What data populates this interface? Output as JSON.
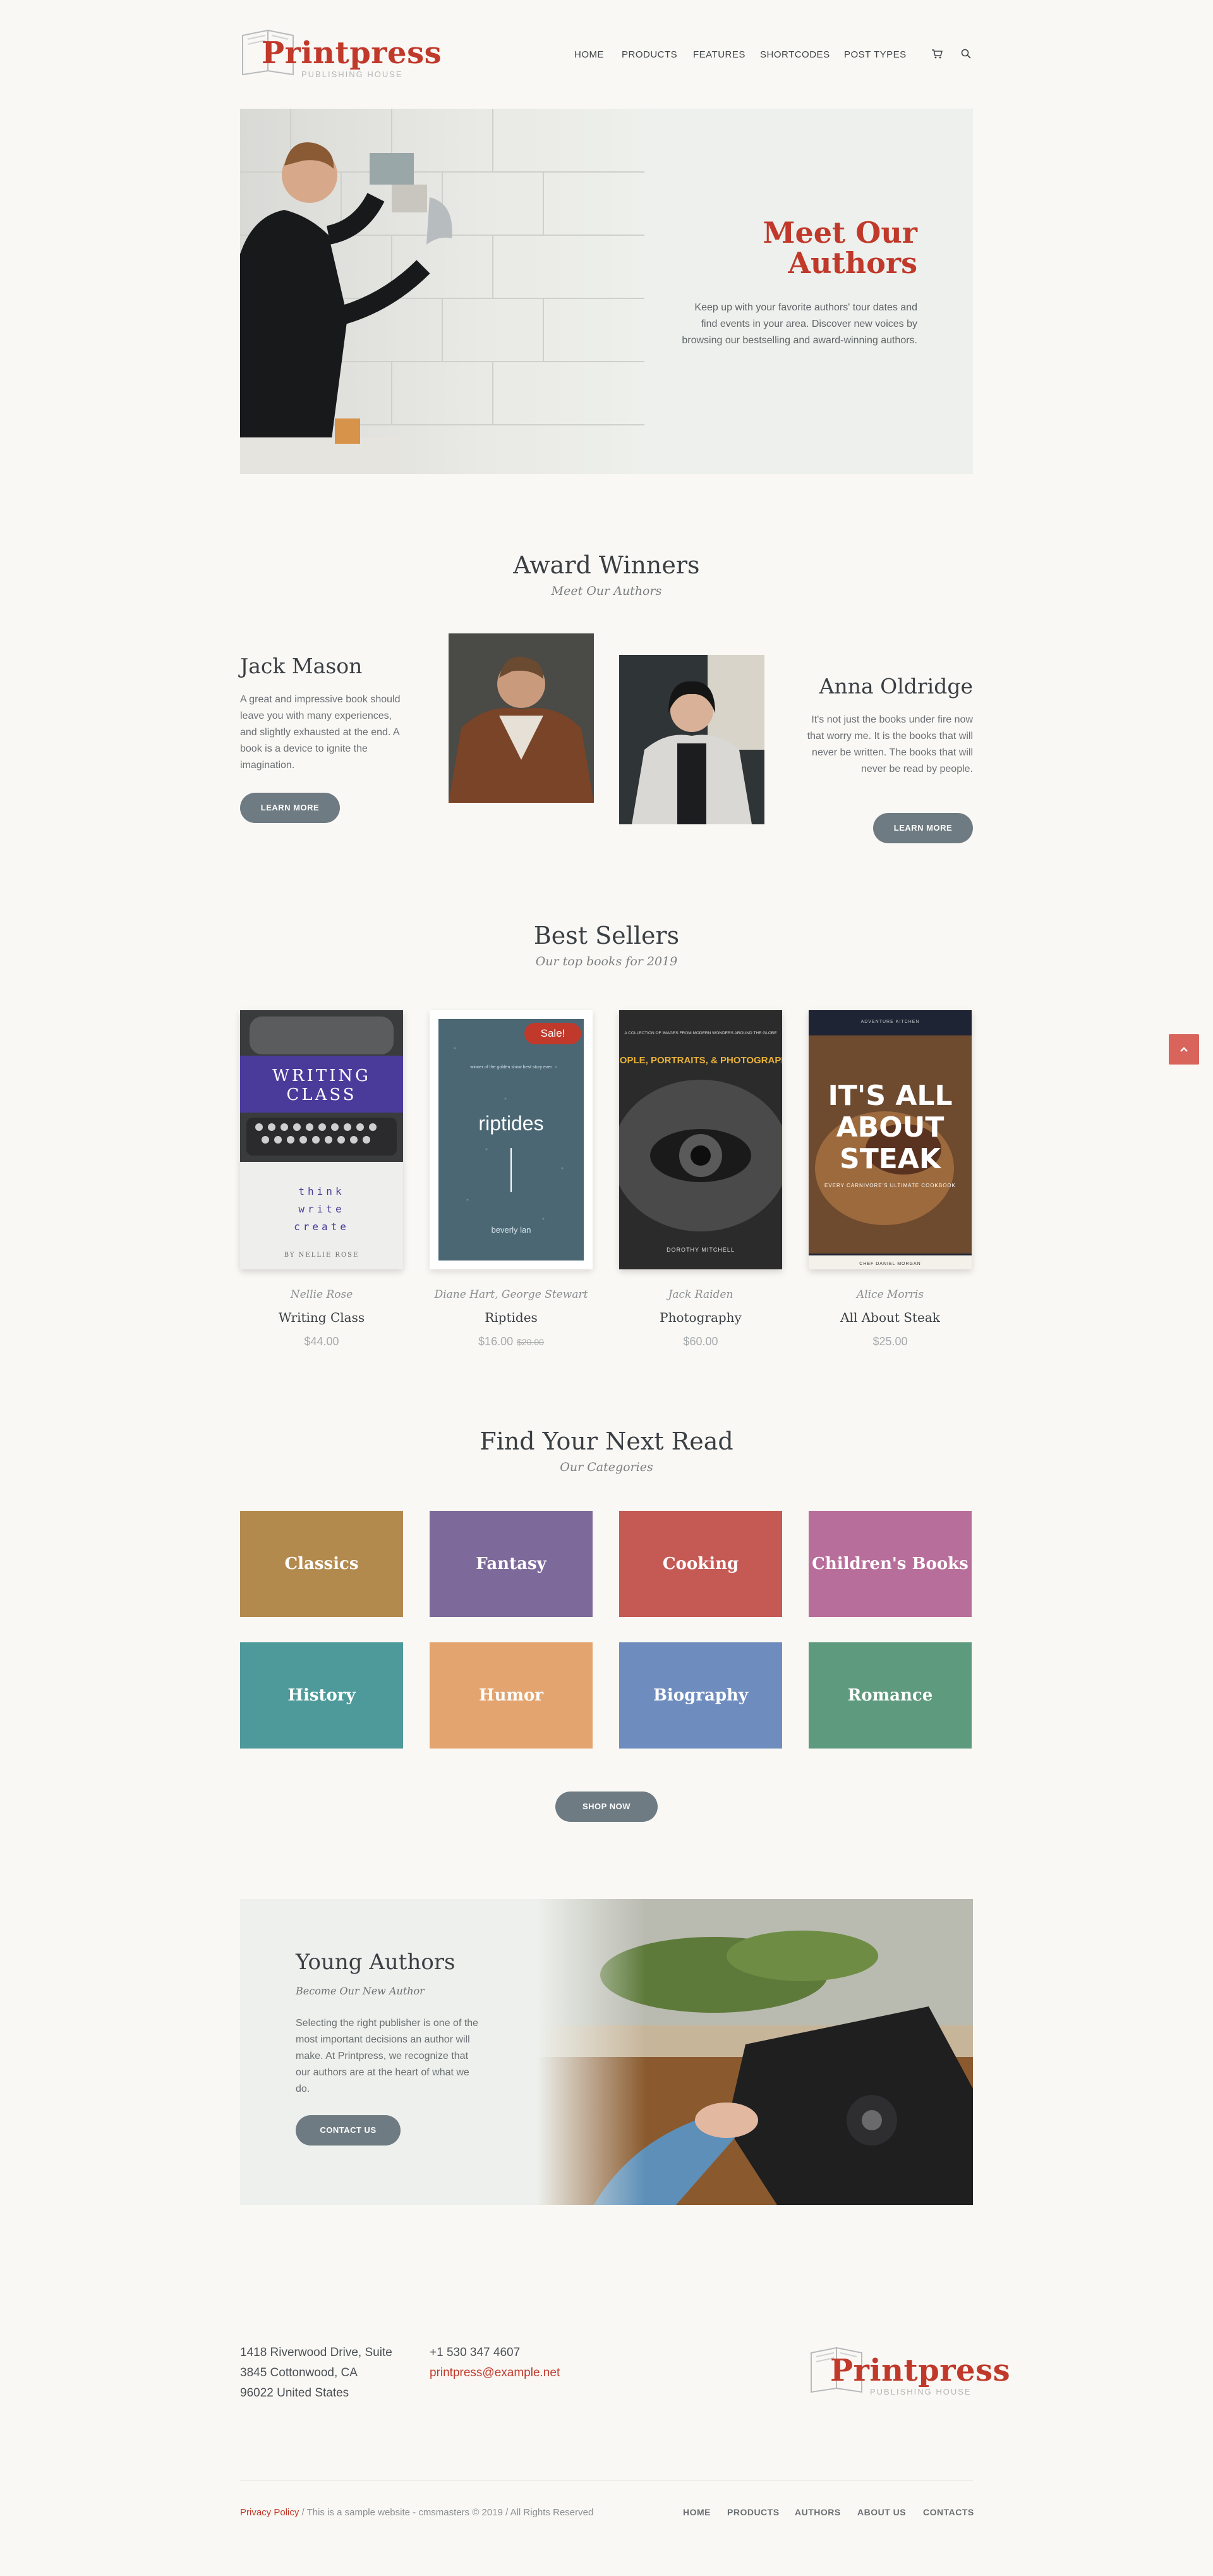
{
  "header": {
    "logo_title": "Printpress",
    "logo_subtitle": "PUBLISHING HOUSE",
    "nav": [
      "HOME",
      "PRODUCTS",
      "FEATURES",
      "SHORTCODES",
      "POST TYPES"
    ]
  },
  "hero": {
    "title_line1": "Meet Our",
    "title_line2": "Authors",
    "text": "Keep up with your favorite authors' tour dates and find events in your area. Discover new voices by browsing our bestselling and award-winning authors."
  },
  "awards": {
    "title": "Award Winners",
    "subtitle": "Meet Our Authors",
    "left": {
      "name": "Jack Mason",
      "text": "A great and impressive book should leave you with many experiences, and slightly exhausted at the end. A book is a device to ignite the imagination.",
      "button": "LEARN MORE"
    },
    "right": {
      "name": "Anna Oldridge",
      "text": "It's not just the books under fire now that worry me. It is the books that will never be written. The books that will never be read by people.",
      "button": "LEARN MORE"
    }
  },
  "bestsellers": {
    "title": "Best Sellers",
    "subtitle": "Our top books for 2019",
    "books": [
      {
        "author": "Nellie Rose",
        "title": "Writing Class",
        "price": "$44.00",
        "old_price": ""
      },
      {
        "author": "Diane Hart, George Stewart",
        "title": "Riptides",
        "price": "$16.00",
        "old_price": "$20.00"
      },
      {
        "author": "Jack Raiden",
        "title": "Photography",
        "price": "$60.00",
        "old_price": ""
      },
      {
        "author": "Alice Morris",
        "title": "All About Steak",
        "price": "$25.00",
        "old_price": ""
      }
    ],
    "sale_badge": "Sale!",
    "covers": {
      "writing_class": {
        "top": "WRITING",
        "bottom": "CLASS",
        "tag1": "think",
        "tag2": "write",
        "tag3": "create",
        "by": "BY NELLIE ROSE"
      },
      "riptides": {
        "small": "winner of the golden show best story ever",
        "title": "riptides",
        "author": "beverly lan"
      },
      "photography": {
        "small": "A COLLECTION OF IMAGES FROM MODERN WONDERS AROUND THE GLOBE",
        "title": "PEOPLE, PORTRAITS, & PHOTOGRAPHY",
        "author": "DOROTHY MITCHELL"
      },
      "steak": {
        "small": "ADVENTURE KITCHEN",
        "title1": "IT'S ALL",
        "title2": "ABOUT",
        "title3": "STEAK",
        "sub": "EVERY CARNIVORE'S ULTIMATE COOKBOOK",
        "author": "CHEF DANIEL MORGAN"
      }
    }
  },
  "categories": {
    "title": "Find Your Next Read",
    "subtitle": "Our Categories",
    "items": [
      {
        "label": "Classics",
        "color": "#b38a4e"
      },
      {
        "label": "Fantasy",
        "color": "#7d6a9a"
      },
      {
        "label": "Cooking",
        "color": "#c55a55"
      },
      {
        "label": "Children's Books",
        "color": "#b86e9a"
      },
      {
        "label": "History",
        "color": "#4e9a9a"
      },
      {
        "label": "Humor",
        "color": "#e3a470"
      },
      {
        "label": "Biography",
        "color": "#6f8cbf"
      },
      {
        "label": "Romance",
        "color": "#5e9a7e"
      }
    ],
    "button": "SHOP NOW"
  },
  "young_author": {
    "title": "Young Authors",
    "subtitle": "Become Our New Author",
    "text": "Selecting the right publisher is one of the most important decisions an author will make. At Printpress, we recognize that our authors are at the heart of what we do.",
    "button": "CONTACT US"
  },
  "footer": {
    "address_line1": "1418 Riverwood Drive, Suite",
    "address_line2": "3845 Cottonwood, CA",
    "address_line3": "96022 United States",
    "phone": "+1 530 347 4607",
    "email": "printpress@example.net",
    "privacy": "Privacy Policy",
    "copyright": " / This is a sample website - cmsmasters © 2019 / All Rights Reserved",
    "nav": [
      "HOME",
      "PRODUCTS",
      "AUTHORS",
      "ABOUT US",
      "CONTACTS"
    ]
  },
  "colors": {
    "accent": "#c0392b",
    "button": "#6f7b82",
    "background": "#faf8f4"
  }
}
